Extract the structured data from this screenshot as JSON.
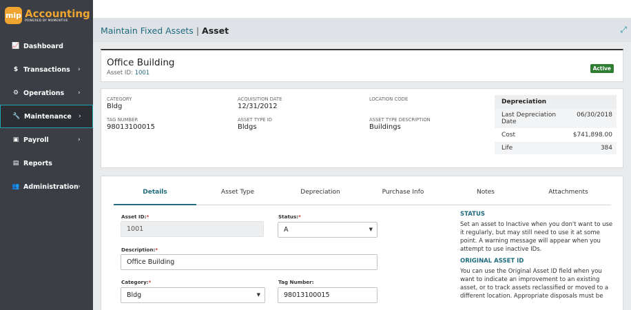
{
  "logo": {
    "badge": "mip",
    "title": "Accounting",
    "subtitle": "POWERED BY MOMENTIVE"
  },
  "nav": [
    {
      "label": "Dashboard",
      "icon": "📈",
      "chev": ""
    },
    {
      "label": "Transactions",
      "icon": "$",
      "chev": "›"
    },
    {
      "label": "Operations",
      "icon": "⚙",
      "chev": "›"
    },
    {
      "label": "Maintenance",
      "icon": "🔧",
      "chev": "›"
    },
    {
      "label": "Payroll",
      "icon": "▣",
      "chev": "›"
    },
    {
      "label": "Reports",
      "icon": "▤",
      "chev": ""
    },
    {
      "label": "Administration",
      "icon": "👥",
      "chev": "›"
    }
  ],
  "breadcrumb": {
    "link": "Maintain Fixed Assets",
    "sep": "|",
    "current": "Asset"
  },
  "header": {
    "title": "Office Building",
    "sub_label": "Asset ID:",
    "sub_value": "1001",
    "status": "Active"
  },
  "info": {
    "category_label": "CATEGORY",
    "category": "Bldg",
    "acq_label": "ACQUISITION DATE",
    "acq": "12/31/2012",
    "loc_label": "LOCATION CODE",
    "loc": "",
    "tag_label": "TAG NUMBER",
    "tag": "98013100015",
    "type_label": "ASSET TYPE ID",
    "type": "Bldgs",
    "typedesc_label": "ASSET TYPE DESCRIPTION",
    "typedesc": "Buildings"
  },
  "depreciation": {
    "title": "Depreciation",
    "rows": [
      {
        "label": "Last Depreciation Date",
        "value": "06/30/2018"
      },
      {
        "label": "Cost",
        "value": "$741,898.00"
      },
      {
        "label": "Life",
        "value": "384"
      }
    ]
  },
  "tabs": [
    "Details",
    "Asset Type",
    "Depreciation",
    "Purchase Info",
    "Notes",
    "Attachments"
  ],
  "form": {
    "asset_id_label": "Asset ID:",
    "asset_id": "1001",
    "status_label": "Status:",
    "status": "A",
    "desc_label": "Description:",
    "desc": "Office Building",
    "category_label": "Category:",
    "category": "Bldg",
    "tag_label": "Tag Number:",
    "tag": "98013100015"
  },
  "help": {
    "status_title": "STATUS",
    "status_text": "Set an asset to Inactive when you don't want to use it regularly, but may still need to use it at some point. A warning message will appear when you attempt to use inactive IDs.",
    "orig_title": "ORIGINAL ASSET ID",
    "orig_text": "You can use the Original Asset ID field when you want to indicate an improvement to an existing asset, or to track assets reclassified or moved to a different location. Appropriate disposals must be"
  },
  "colors": {
    "accent": "#1f6b7e",
    "brand": "#f0a531",
    "active": "#2f7d32",
    "sidebar": "#3b3f45"
  }
}
